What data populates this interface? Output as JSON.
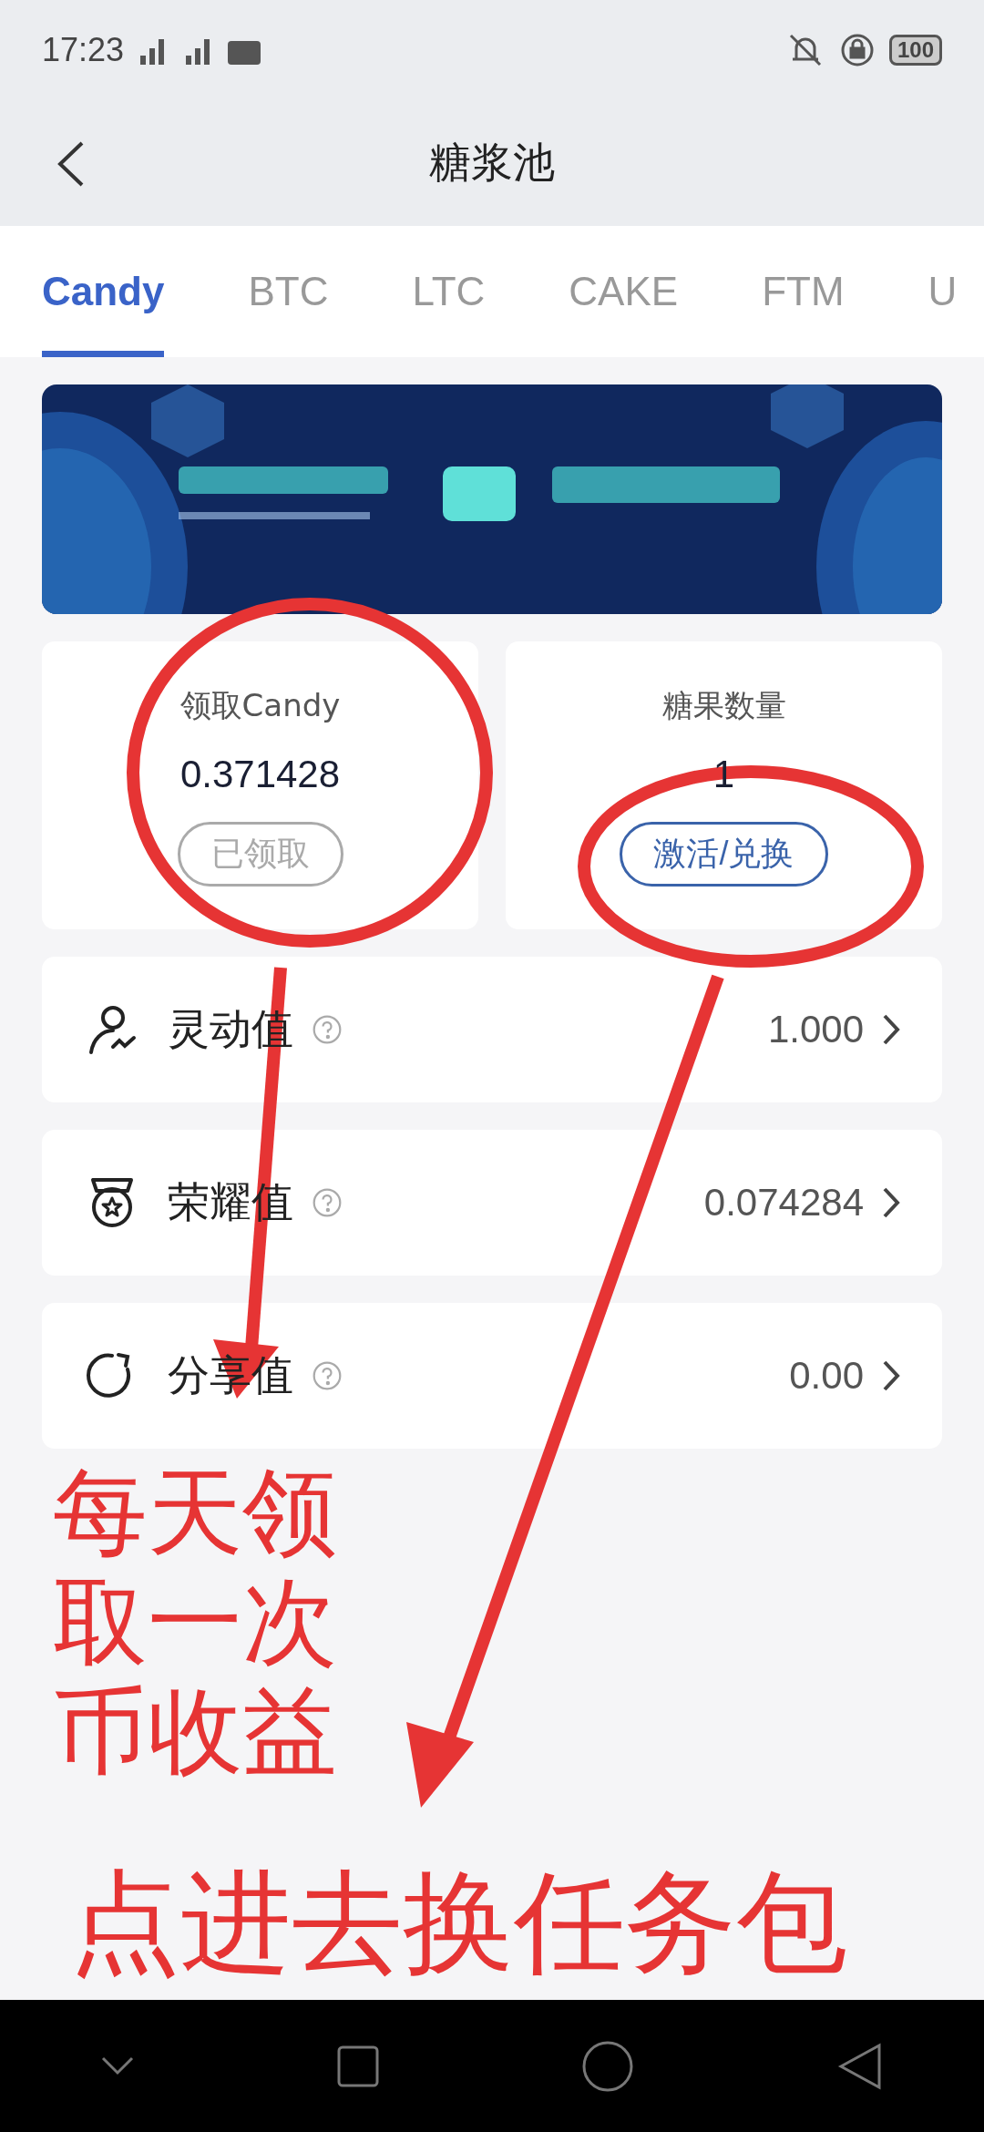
{
  "status_bar": {
    "time": "17:23",
    "battery": "100"
  },
  "header": {
    "title": "糖浆池"
  },
  "tabs": [
    {
      "label": "Candy",
      "selected": true
    },
    {
      "label": "BTC",
      "selected": false
    },
    {
      "label": "LTC",
      "selected": false
    },
    {
      "label": "CAKE",
      "selected": false
    },
    {
      "label": "FTM",
      "selected": false
    },
    {
      "label": "U",
      "selected": false
    }
  ],
  "cards": [
    {
      "label": "领取Candy",
      "value": "0.371428",
      "button": "已领取",
      "disabled": true
    },
    {
      "label": "糖果数量",
      "value": "1",
      "button": "激活/兑换",
      "disabled": false
    }
  ],
  "rows": [
    {
      "label": "灵动值",
      "value": "1.000"
    },
    {
      "label": "荣耀值",
      "value": "0.074284"
    },
    {
      "label": "分享值",
      "value": "0.00"
    }
  ],
  "annotations": {
    "left_note": [
      "每天领",
      "取一次",
      "币收益"
    ],
    "bottom_note": "点进去换任务包"
  }
}
